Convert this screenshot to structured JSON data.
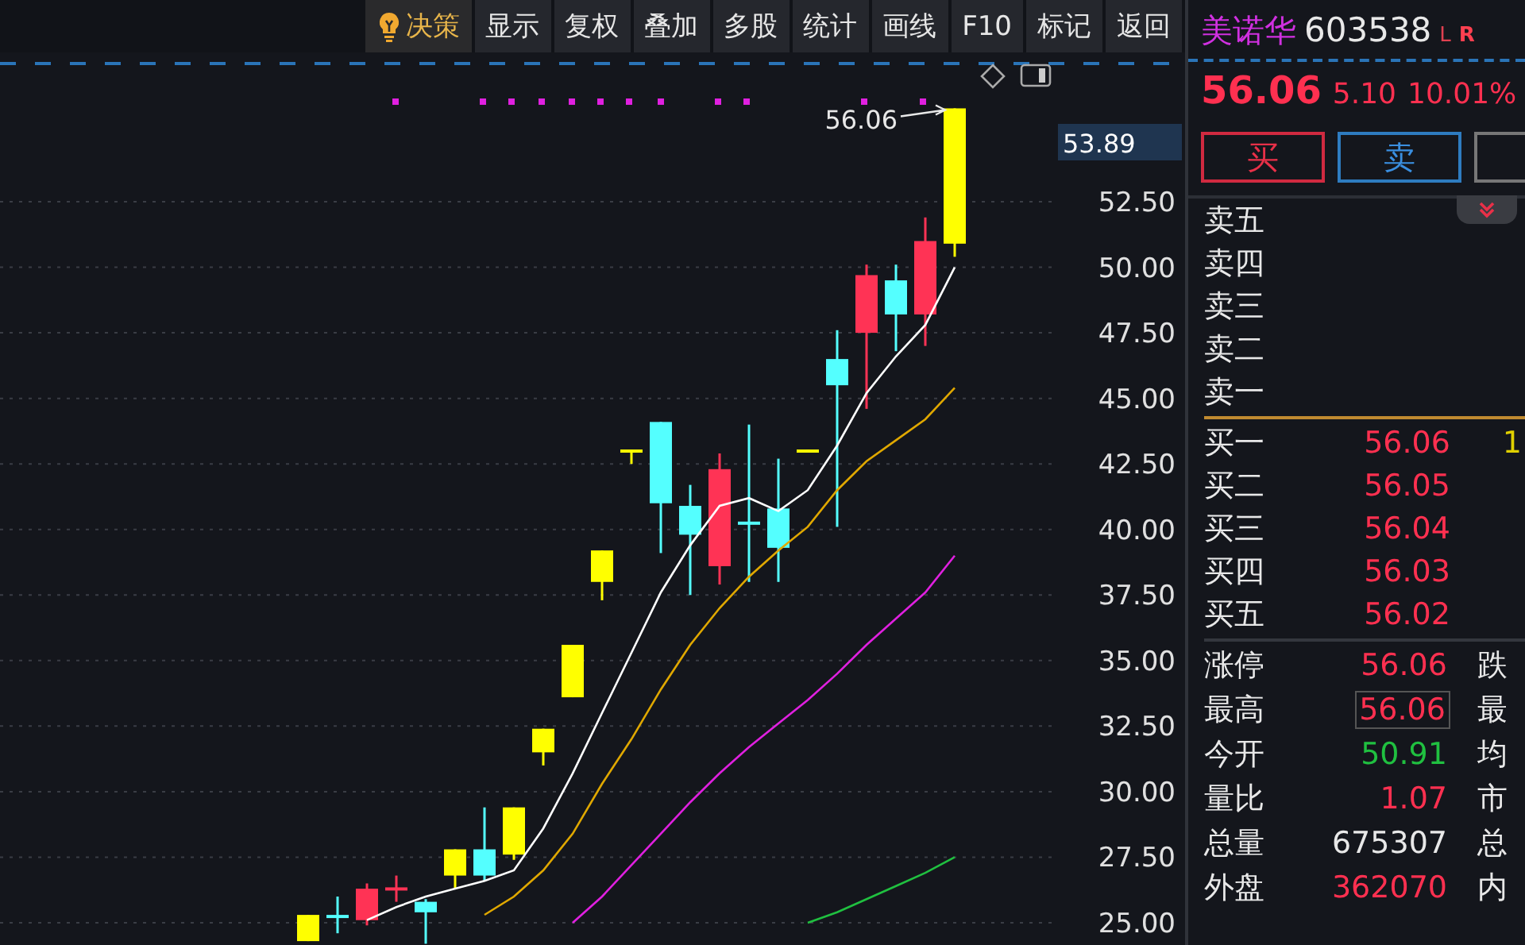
{
  "toolbar": {
    "buttons": [
      {
        "label": "决策",
        "kind": "decision"
      },
      {
        "label": "显示",
        "kind": "plain"
      },
      {
        "label": "复权",
        "kind": "plain"
      },
      {
        "label": "叠加",
        "kind": "plain"
      },
      {
        "label": "多股",
        "kind": "plain"
      },
      {
        "label": "统计",
        "kind": "plain"
      },
      {
        "label": "画线",
        "kind": "plain"
      },
      {
        "label": "F10",
        "kind": "plain"
      },
      {
        "label": "标记",
        "kind": "plain"
      },
      {
        "label": "返回",
        "kind": "plain"
      }
    ]
  },
  "chart": {
    "price_tag": "53.89",
    "chart_data": {
      "type": "candlestick",
      "grid": true,
      "ylim": [
        25,
        57.77
      ],
      "ohlc": [
        [
          24.3,
          25.3,
          24.3,
          25.3
        ],
        [
          25.25,
          26.0,
          24.6,
          25.3
        ],
        [
          25.1,
          26.5,
          24.9,
          26.3
        ],
        [
          26.3,
          26.8,
          25.8,
          26.35
        ],
        [
          25.8,
          25.9,
          24.2,
          25.4
        ],
        [
          26.8,
          27.8,
          26.3,
          27.8
        ],
        [
          27.8,
          29.4,
          26.6,
          26.8
        ],
        [
          27.6,
          29.4,
          27.4,
          29.4
        ],
        [
          31.5,
          32.4,
          31.0,
          32.4
        ],
        [
          33.6,
          35.6,
          33.6,
          35.6
        ],
        [
          38.0,
          39.2,
          37.3,
          39.2
        ],
        [
          43.0,
          43.05,
          42.5,
          43.05
        ],
        [
          44.1,
          44.1,
          39.1,
          41.0
        ],
        [
          40.9,
          41.7,
          37.5,
          39.8
        ],
        [
          38.6,
          42.9,
          37.9,
          42.3
        ],
        [
          40.3,
          44.0,
          38.0,
          40.2
        ],
        [
          40.8,
          42.7,
          38.0,
          39.3
        ],
        [
          43.0,
          43.05,
          43.0,
          43.05
        ],
        [
          46.5,
          47.6,
          40.1,
          45.5
        ],
        [
          47.5,
          50.1,
          44.6,
          49.7
        ],
        [
          49.5,
          50.1,
          46.8,
          48.2
        ],
        [
          48.2,
          51.9,
          47.0,
          51.0
        ],
        [
          50.9,
          56.06,
          50.4,
          56.06
        ]
      ],
      "colors": [
        "#ffff00",
        "#54ffff",
        "#ff3355",
        "#ff3355",
        "#54ffff",
        "#ffff00",
        "#54ffff",
        "#ffff00",
        "#ffff00",
        "#ffff00",
        "#ffff00",
        "#ffff00",
        "#54ffff",
        "#54ffff",
        "#ff3355",
        "#54ffff",
        "#54ffff",
        "#ffff00",
        "#54ffff",
        "#ff3355",
        "#54ffff",
        "#ff3355",
        "#ffff00"
      ],
      "yticks": [
        {
          "value": 25,
          "label": "25.00"
        },
        {
          "value": 27.5,
          "label": "27.50"
        },
        {
          "value": 30,
          "label": "30.00"
        },
        {
          "value": 32.5,
          "label": "32.50"
        },
        {
          "value": 35,
          "label": "35.00"
        },
        {
          "value": 37.5,
          "label": "37.50"
        },
        {
          "value": 40,
          "label": "40.00"
        },
        {
          "value": 42.5,
          "label": "42.50"
        },
        {
          "value": 45,
          "label": "45.00"
        },
        {
          "value": 47.5,
          "label": "47.50"
        },
        {
          "value": 50,
          "label": "50.00"
        },
        {
          "value": 52.5,
          "label": "52.50"
        }
      ],
      "series": [
        {
          "type": "line",
          "color": "#ffffff",
          "values": [
            null,
            null,
            25.1,
            25.6,
            26.0,
            26.3,
            26.6,
            27.0,
            28.6,
            30.7,
            33.0,
            35.3,
            37.6,
            39.4,
            40.9,
            41.2,
            40.7,
            41.5,
            43.2,
            45.2,
            46.6,
            47.8,
            50.0
          ]
        },
        {
          "type": "line",
          "color": "#e0a800",
          "values": [
            null,
            null,
            null,
            null,
            null,
            null,
            25.3,
            26.0,
            27.0,
            28.4,
            30.3,
            32.0,
            33.9,
            35.6,
            37.0,
            38.2,
            39.2,
            40.1,
            41.5,
            42.6,
            43.4,
            44.2,
            45.4
          ]
        },
        {
          "type": "line",
          "color": "#e020e0",
          "values": [
            null,
            null,
            null,
            null,
            null,
            null,
            null,
            null,
            null,
            25.0,
            26.0,
            27.2,
            28.4,
            29.6,
            30.7,
            31.7,
            32.6,
            33.5,
            34.5,
            35.6,
            36.6,
            37.6,
            39.0
          ]
        },
        {
          "type": "line",
          "color": "#20c040",
          "values": [
            null,
            null,
            null,
            null,
            null,
            null,
            null,
            null,
            null,
            null,
            null,
            null,
            null,
            null,
            null,
            null,
            null,
            25.0,
            25.4,
            25.9,
            26.4,
            26.9,
            27.5
          ]
        }
      ],
      "annotations": [
        "56.06"
      ]
    }
  },
  "quote": {
    "name": "美诺华",
    "code": "603538",
    "flags": [
      {
        "label": "L",
        "bold": false
      },
      {
        "label": "R",
        "bold": true
      }
    ],
    "price": "56.06",
    "change": "5.10",
    "change_pct": "10.01%",
    "trade_buttons": [
      {
        "label": "买",
        "kind": "buy"
      },
      {
        "label": "卖",
        "kind": "sell"
      },
      {
        "kind": "other"
      }
    ]
  },
  "order_book": {
    "asks": [
      {
        "label": "卖五"
      },
      {
        "label": "卖四"
      },
      {
        "label": "卖三"
      },
      {
        "label": "卖二"
      },
      {
        "label": "卖一"
      }
    ],
    "bids": [
      {
        "label": "买一",
        "price": "56.06",
        "volume": "1"
      },
      {
        "label": "买二",
        "price": "56.05"
      },
      {
        "label": "买三",
        "price": "56.04"
      },
      {
        "label": "买四",
        "price": "56.03"
      },
      {
        "label": "买五",
        "price": "56.02"
      }
    ]
  },
  "stats": [
    {
      "label": "涨停",
      "value": "56.06",
      "color": "#ff3050",
      "boxed": false,
      "label_2": "跌"
    },
    {
      "label": "最高",
      "value": "56.06",
      "color": "#ff3050",
      "boxed": true,
      "label_2": "最"
    },
    {
      "label": "今开",
      "value": "50.91",
      "color": "#20c040",
      "boxed": false,
      "label_2": "均"
    },
    {
      "label": "量比",
      "value": "1.07",
      "color": "#ff3050",
      "boxed": false,
      "label_2": "市"
    },
    {
      "label": "总量",
      "value": "675307",
      "color": "#e8e8e8",
      "boxed": false,
      "label_2": "总"
    },
    {
      "label": "外盘",
      "value": "362070",
      "color": "#ff3050",
      "boxed": false,
      "label_2": "内"
    }
  ]
}
